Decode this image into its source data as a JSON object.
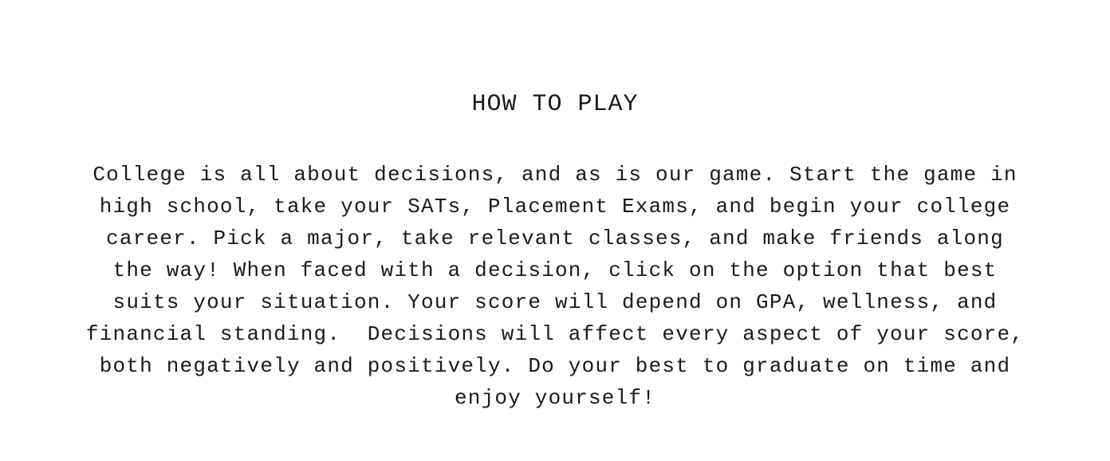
{
  "screen": {
    "title": "HOW TO PLAY",
    "instructions_lines": [
      "College is all about decisions, and as is our game. Start the game in",
      "high school, take your SATs, Placement Exams, and begin your college",
      "career. Pick a major, take relevant classes, and make friends along",
      "the way! When faced with a decision, click on the option that best",
      "suits your situation. Your score will depend on GPA, wellness, and",
      "financial standing.  Decisions will affect every aspect of your score,",
      "both negatively and positively. Do your best to graduate on time and",
      "enjoy yourself!"
    ]
  },
  "colors": {
    "background": "#ffffff",
    "text": "#1a1a1a"
  }
}
